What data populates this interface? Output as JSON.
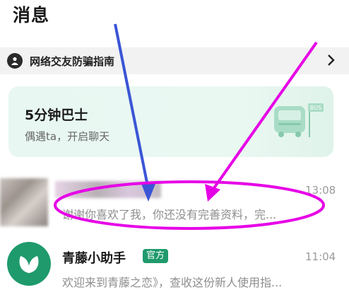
{
  "header": {
    "title": "消息"
  },
  "banner": {
    "text": "网络交友防骗指南",
    "icon": "shield-user-icon",
    "chevron": "›"
  },
  "bus_card": {
    "title": "5分钟巴士",
    "subtitle": "偶遇ta，开启聊天",
    "icon": "bus-icon",
    "icon_label": "BUS"
  },
  "messages": [
    {
      "name": "",
      "time": "13:08",
      "preview": "谢谢你喜欢了我，你还没有完善资料，完..."
    },
    {
      "name": "青藤小助手",
      "badge": "官方",
      "time": "11:04",
      "preview": "欢迎来到青藤之恋》，查收这份新人使用指..."
    }
  ],
  "colors": {
    "accent_green": "#1f9a6d",
    "annotation_magenta": "#e600e6",
    "annotation_blue": "#3b55d6"
  }
}
